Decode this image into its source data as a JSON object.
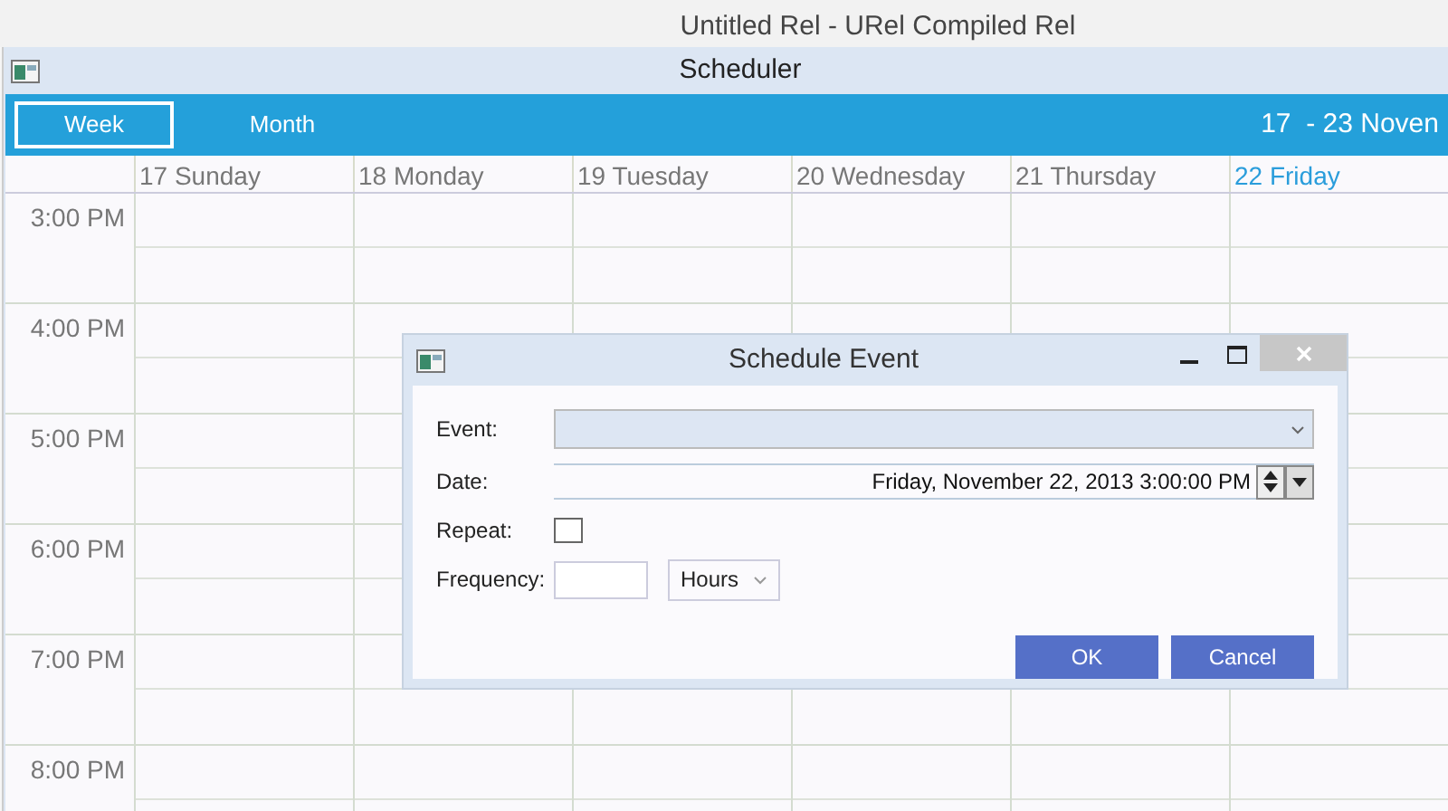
{
  "background_window": {
    "title": "Untitled Rel - URel Compiled Rel"
  },
  "window": {
    "title": "Scheduler"
  },
  "view_tabs": [
    {
      "label": "Week",
      "selected": true
    },
    {
      "label": "Month",
      "selected": false
    }
  ],
  "date_range": "17  - 23 Noven",
  "days": [
    {
      "label": "17 Sunday",
      "today": false
    },
    {
      "label": "18 Monday",
      "today": false
    },
    {
      "label": "19 Tuesday",
      "today": false
    },
    {
      "label": "20 Wednesday",
      "today": false
    },
    {
      "label": "21 Thursday",
      "today": false
    },
    {
      "label": "22 Friday",
      "today": true
    }
  ],
  "hours": [
    "3:00 PM",
    "4:00 PM",
    "5:00 PM",
    "6:00 PM",
    "7:00 PM",
    "8:00 PM"
  ],
  "dialog": {
    "title": "Schedule Event",
    "event_label": "Event:",
    "date_label": "Date:",
    "date_value": "Friday, November 22, 2013 3:00:00 PM",
    "repeat_label": "Repeat:",
    "repeat_checked": false,
    "frequency_label": "Frequency:",
    "frequency_unit": "Hours",
    "buttons": [
      "OK",
      "Cancel"
    ]
  }
}
